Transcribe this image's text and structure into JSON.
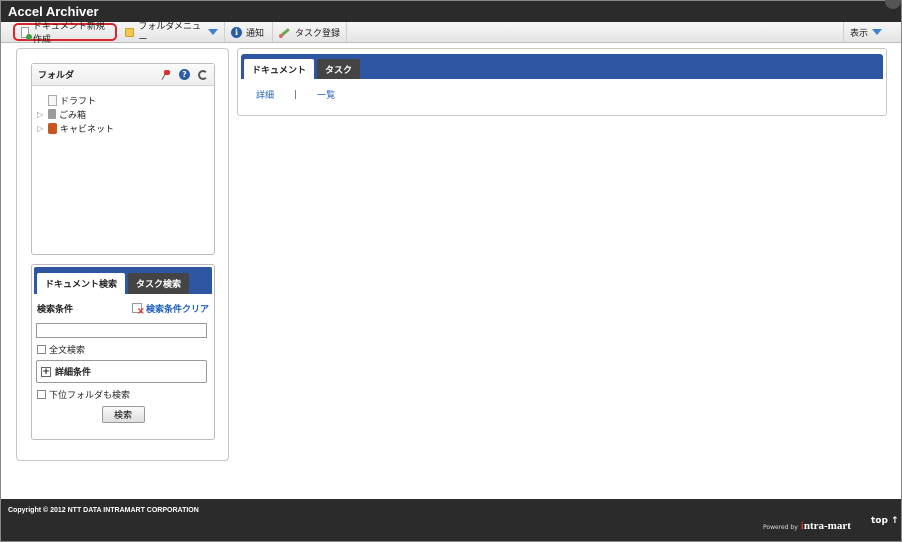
{
  "app": {
    "title": "Accel Archiver"
  },
  "toolbar": {
    "new_document": "ドキュメント新規作成",
    "folder_menu": "フォルダメニュー",
    "notice": "通知",
    "task_register": "タスク登録",
    "display": "表示",
    "highlight_color": "#d9252a"
  },
  "folder_panel": {
    "title": "フォルダ",
    "items": [
      {
        "label": "ドラフト",
        "icon": "draft-icon",
        "expandable": false
      },
      {
        "label": "ごみ箱",
        "icon": "trash-icon",
        "expandable": true
      },
      {
        "label": "キャビネット",
        "icon": "cabinet-icon",
        "expandable": true
      }
    ]
  },
  "search_panel": {
    "tabs": [
      "ドキュメント検索",
      "タスク検索"
    ],
    "active_tab": 0,
    "condition_label": "検索条件",
    "clear_label": "検索条件クリア",
    "query_value": "",
    "fulltext_label": "全文検索",
    "detail_label": "詳細条件",
    "subfolder_label": "下位フォルダも検索",
    "search_button": "検索"
  },
  "main_panel": {
    "tabs": [
      "ドキュメント",
      "タスク"
    ],
    "active_tab": 0,
    "links": [
      "詳細",
      "一覧"
    ],
    "tab_bar_color": "#2f56a3"
  },
  "footer": {
    "copyright": "Copyright © 2012 NTT DATA INTRAMART CORPORATION",
    "powered_by": "Powered by",
    "brand": "intra-mart",
    "top_link": "top ↑"
  }
}
